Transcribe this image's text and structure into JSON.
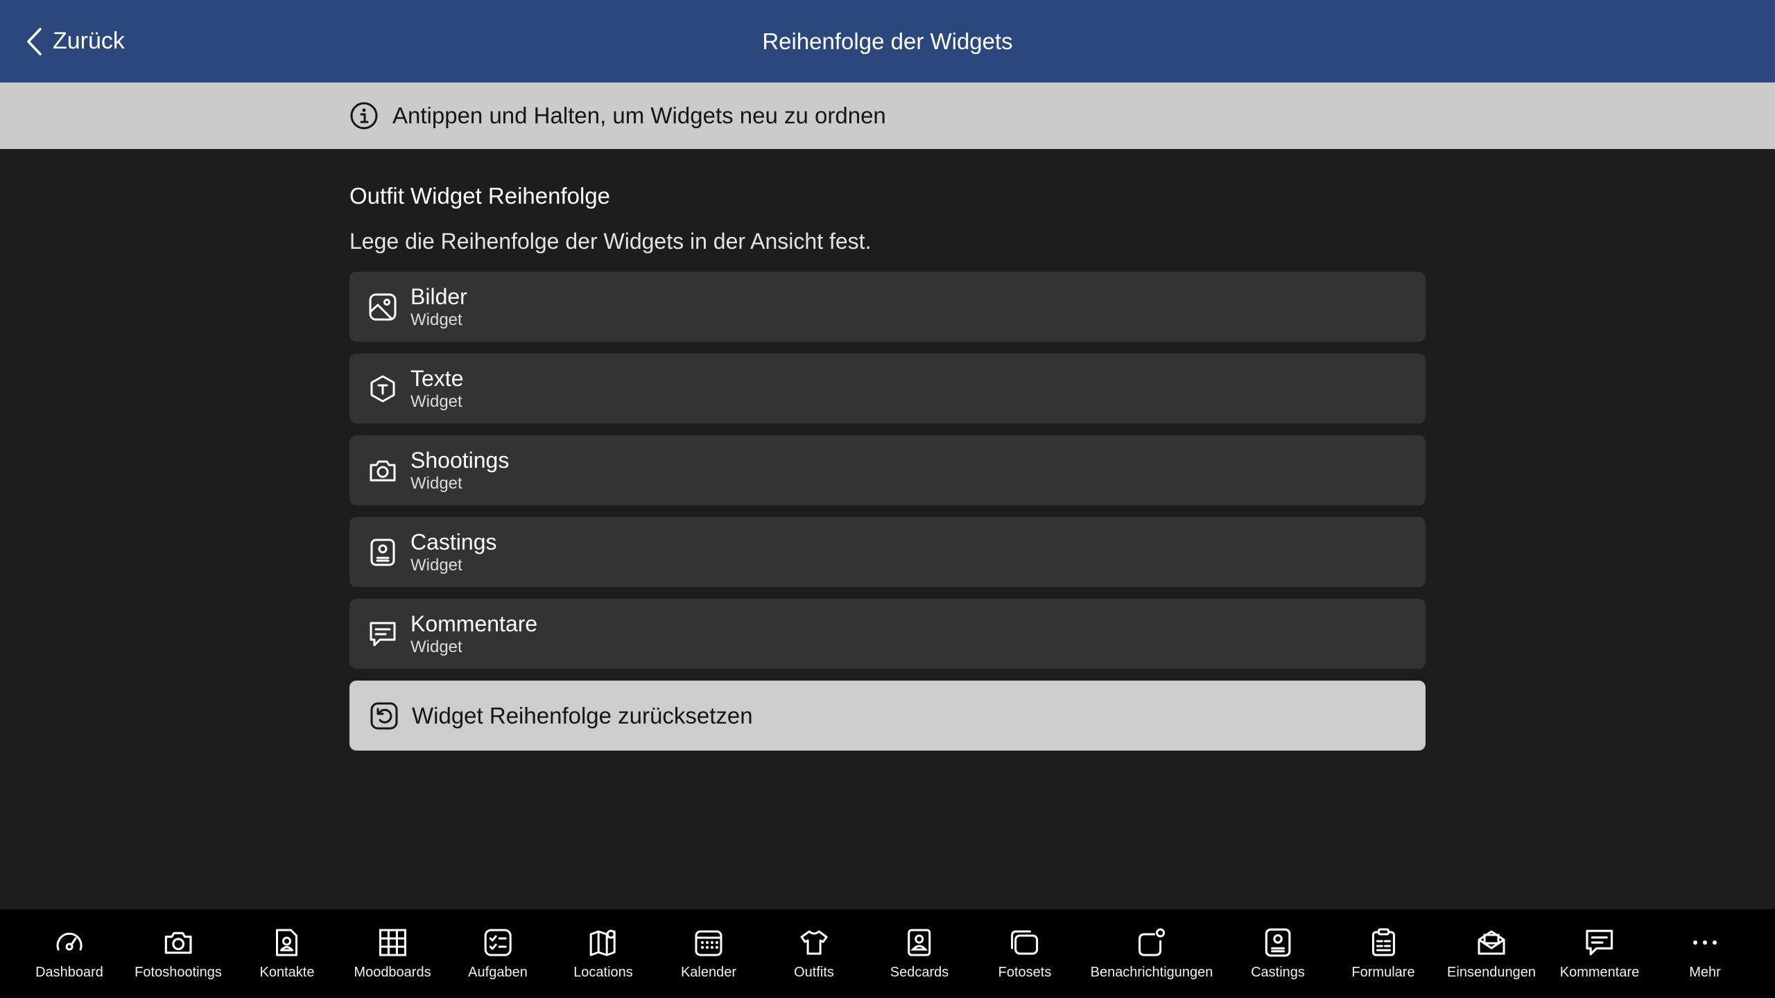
{
  "header": {
    "back_label": "Zurück",
    "title": "Reihenfolge der Widgets"
  },
  "info_banner": {
    "text": "Antippen und Halten, um Widgets neu zu ordnen",
    "icon": "info-icon"
  },
  "section": {
    "title": "Outfit Widget Reihenfolge",
    "description": "Lege die Reihenfolge der Widgets in der Ansicht fest."
  },
  "widgets": [
    {
      "name": "Bilder",
      "sub": "Widget",
      "icon": "image-icon"
    },
    {
      "name": "Texte",
      "sub": "Widget",
      "icon": "text-icon"
    },
    {
      "name": "Shootings",
      "sub": "Widget",
      "icon": "camera-icon"
    },
    {
      "name": "Castings",
      "sub": "Widget",
      "icon": "casting-icon"
    },
    {
      "name": "Kommentare",
      "sub": "Widget",
      "icon": "comment-icon"
    }
  ],
  "reset_button": {
    "label": "Widget Reihenfolge zurücksetzen",
    "icon": "reset-icon"
  },
  "tabbar": [
    {
      "label": "Dashboard",
      "icon": "dashboard-icon"
    },
    {
      "label": "Fotoshootings",
      "icon": "camera-icon"
    },
    {
      "label": "Kontakte",
      "icon": "contact-icon"
    },
    {
      "label": "Moodboards",
      "icon": "moodboard-icon"
    },
    {
      "label": "Aufgaben",
      "icon": "tasks-icon"
    },
    {
      "label": "Locations",
      "icon": "map-icon"
    },
    {
      "label": "Kalender",
      "icon": "calendar-icon"
    },
    {
      "label": "Outfits",
      "icon": "shirt-icon"
    },
    {
      "label": "Sedcards",
      "icon": "sedcard-icon"
    },
    {
      "label": "Fotosets",
      "icon": "photoset-icon"
    },
    {
      "label": "Benachrichtigungen",
      "icon": "notification-icon"
    },
    {
      "label": "Castings",
      "icon": "casting-icon"
    },
    {
      "label": "Formulare",
      "icon": "form-icon"
    },
    {
      "label": "Einsendungen",
      "icon": "submission-icon"
    },
    {
      "label": "Kommentare",
      "icon": "comment-icon"
    },
    {
      "label": "Mehr",
      "icon": "more-icon"
    }
  ]
}
